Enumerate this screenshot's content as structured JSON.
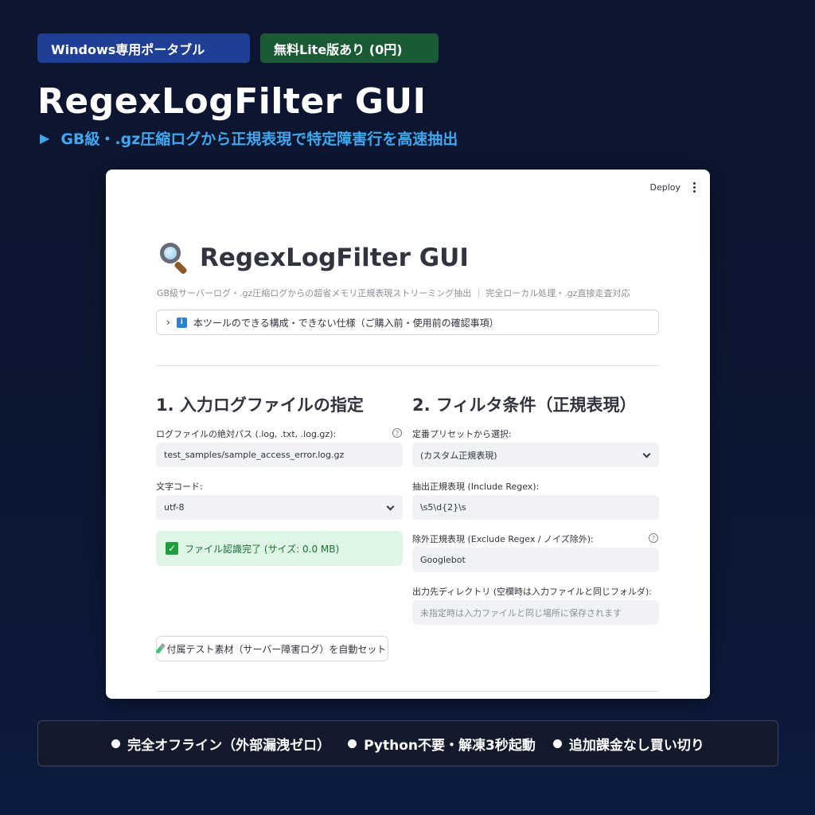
{
  "badges": {
    "windows": "Windows専用ポータブル",
    "lite": "無料Lite版あり (0円)"
  },
  "hero": {
    "title": "RegexLogFilter GUI",
    "subtitle_marker": "▶",
    "subtitle": "GB級・.gz圧縮ログから正規表現で特定障害行を高速抽出"
  },
  "app": {
    "deploy_label": "Deploy",
    "title": "RegexLogFilter GUI",
    "caption": "GB級サーバーログ・.gz圧縮ログからの超省メモリ正規表現ストリーミング抽出 ｜ 完全ローカル処理・.gz直接走査対応",
    "expander": {
      "chevron": "›",
      "info_glyph": "i",
      "label": "本ツールのできる構成・できない仕様（ご購入前・使用前の確認事項）"
    },
    "section1": {
      "heading": "1. 入力ログファイルの指定",
      "path_label": "ログファイルの絶対パス (.log, .txt, .log.gz):",
      "path_value": "test_samples/sample_access_error.log.gz",
      "encoding_label": "文字コード:",
      "encoding_value": "utf-8",
      "success_text": "ファイル認識完了 (サイズ: 0.0 MB)"
    },
    "section2": {
      "heading": "2. フィルタ条件（正規表現）",
      "preset_label": "定番プリセットから選択:",
      "preset_value": "(カスタム正規表現)",
      "include_label": "抽出正規表現 (Include Regex):",
      "include_value": "\\s5\\d{2}\\s",
      "exclude_label": "除外正規表現 (Exclude Regex / ノイズ除外):",
      "exclude_value": "Googlebot",
      "output_label": "出力先ディレクトリ (空欄時は入力ファイルと同じフォルダ):",
      "output_placeholder": "未指定時は入力ファイルと同じ場所に保存されます"
    },
    "sample_button": "付属テスト素材（サーバー障害ログ）を自動セット",
    "help_glyph": "?"
  },
  "footer": {
    "item1": "完全オフライン（外部漏洩ゼロ）",
    "item2": "Python不要・解凍3秒起動",
    "item3": "追加課金なし買い切り"
  },
  "colors": {
    "badge_blue": "#1f3f94",
    "badge_green": "#1a5a35",
    "subtitle_accent": "#3fa8f0",
    "success_bg": "#dff5e6",
    "success_text": "#177233"
  }
}
